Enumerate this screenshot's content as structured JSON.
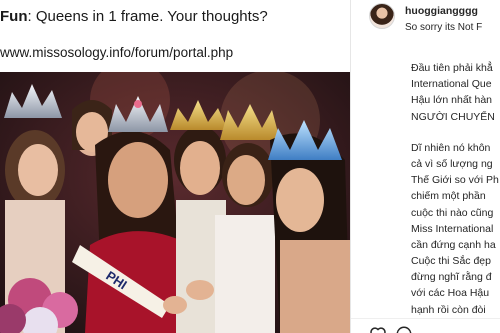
{
  "post": {
    "caption_prefix": "Fun",
    "caption_text": ": Queens in 1 frame. Your thoughts?",
    "source_url": "www.missosology.info/forum/portal.php",
    "sash_text": "PHI"
  },
  "sidebar": {
    "username": "huoggiangggg",
    "status_line": "So sorry its Not F",
    "comment_lines_para1": [
      "Đầu tiên phải khẳ",
      "International Que",
      "Hậu lớn nhất hàn",
      "NGƯỜI CHUYỂN"
    ],
    "comment_lines_para2": [
      "Dĩ nhiên nó khôn",
      "cả vì số lượng ng",
      "Thế Giới so với Ph",
      "chiếm một phần",
      "cuộc thi nào cũng",
      "Miss International",
      "cần đứng cạnh ha",
      "Cuộc thi Sắc đẹp",
      "đừng nghĩ rằng đ",
      "với các Hoa Hậu",
      "hạnh rồi còn đòi"
    ]
  },
  "icons": [
    "heart-icon",
    "comment-icon"
  ],
  "colors": {
    "panel_bg": "#ffffff",
    "text": "#262626",
    "backdrop": "#1d1012",
    "gown_red": "#a8132a",
    "crown_gold": "#d9b24a"
  }
}
